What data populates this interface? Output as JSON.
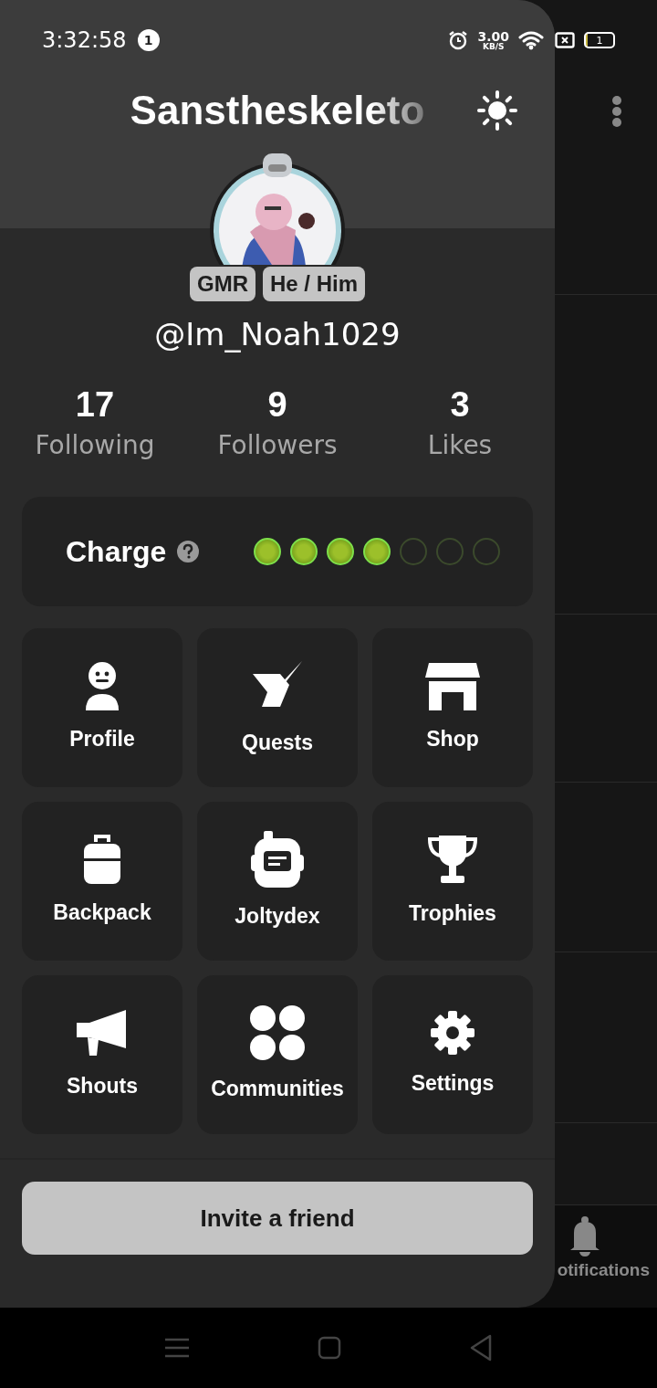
{
  "status_bar": {
    "time": "3:32:58",
    "notification_count": "1",
    "net_speed": "3.00",
    "net_unit": "KB/S",
    "battery": "1"
  },
  "drawer": {
    "title": "Sanstheskeleto",
    "avatar": {
      "kind": "picture"
    },
    "badges": [
      "GMR",
      "He / Him"
    ],
    "username": "@Im_Noah1029",
    "stats": [
      {
        "value": "17",
        "label": "Following"
      },
      {
        "value": "9",
        "label": "Followers"
      },
      {
        "value": "3",
        "label": "Likes"
      }
    ],
    "charge": {
      "label": "Charge",
      "pips": [
        {
          "on": true
        },
        {
          "on": true
        },
        {
          "on": true
        },
        {
          "on": true
        },
        {
          "on": false
        },
        {
          "on": false
        },
        {
          "on": false
        }
      ]
    },
    "tiles": [
      {
        "label": "Profile"
      },
      {
        "label": "Quests"
      },
      {
        "label": "Shop"
      },
      {
        "label": "Backpack"
      },
      {
        "label": "Joltydex"
      },
      {
        "label": "Trophies"
      },
      {
        "label": "Shouts"
      },
      {
        "label": "Communities"
      },
      {
        "label": "Settings"
      }
    ],
    "invite_button": "Invite a friend"
  },
  "background_app": {
    "nav_label": "otifications"
  }
}
